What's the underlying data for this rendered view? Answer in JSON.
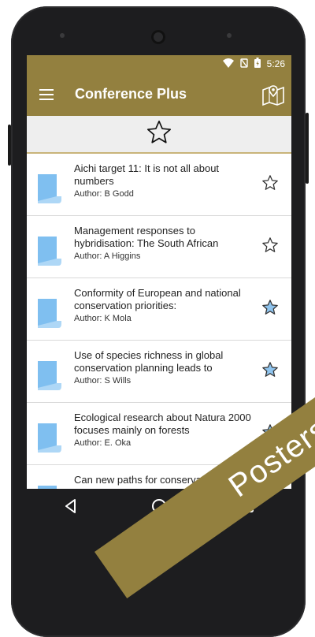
{
  "status": {
    "time": "5:26",
    "wifi_icon": "wifi-icon",
    "battery_icon": "battery-icon"
  },
  "appbar": {
    "title": "Conference Plus",
    "menu_icon": "hamburger-menu-icon",
    "map_icon": "map-icon"
  },
  "filter": {
    "icon": "star-outline-icon"
  },
  "items": [
    {
      "title": "Aichi target 11: It is not all about numbers",
      "author": "Author: B Godd",
      "favorite": false
    },
    {
      "title": "Management responses to hybridisation: The South African",
      "author": "Author: A Higgins",
      "favorite": false
    },
    {
      "title": "Conformity of European and national conservation priorities:",
      "author": "Author: K Mola",
      "favorite": true
    },
    {
      "title": "Use of species richness in global conservation planning leads to",
      "author": "Author: S Wills",
      "favorite": true
    },
    {
      "title": "Ecological research about Natura 2000 focuses mainly on forests",
      "author": "Author: E. Oka",
      "favorite": true
    },
    {
      "title": "Can new paths for conservation",
      "author": "",
      "favorite": false
    }
  ],
  "banner": {
    "label": "Posters"
  },
  "colors": {
    "brand": "#93803f",
    "star_fill": "#8fc4ee",
    "doc_icon": "#64b5f6"
  }
}
